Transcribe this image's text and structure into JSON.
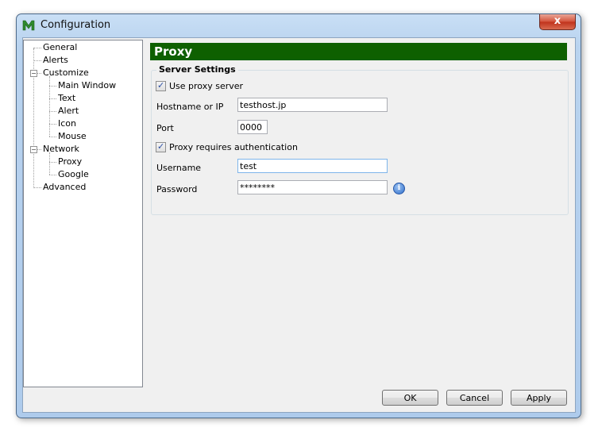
{
  "window": {
    "title": "Configuration",
    "close_label": "x"
  },
  "tree": {
    "items": [
      {
        "label": "General"
      },
      {
        "label": "Alerts"
      },
      {
        "label": "Customize",
        "expander": "−"
      },
      {
        "label": "Main Window"
      },
      {
        "label": "Text"
      },
      {
        "label": "Alert"
      },
      {
        "label": "Icon"
      },
      {
        "label": "Mouse"
      },
      {
        "label": "Network",
        "expander": "−"
      },
      {
        "label": "Proxy"
      },
      {
        "label": "Google"
      },
      {
        "label": "Advanced"
      }
    ]
  },
  "panel": {
    "header": "Proxy",
    "group_title": "Server Settings",
    "use_proxy": {
      "label": "Use proxy server",
      "checked": true
    },
    "hostname": {
      "label": "Hostname or IP",
      "value": "testhost.jp"
    },
    "port": {
      "label": "Port",
      "value": "0000"
    },
    "auth": {
      "label": "Proxy requires authentication",
      "checked": true
    },
    "username": {
      "label": "Username",
      "value": "test"
    },
    "password": {
      "label": "Password",
      "value": "********"
    },
    "info_icon": "i"
  },
  "buttons": {
    "ok": "OK",
    "cancel": "Cancel",
    "apply": "Apply"
  },
  "colors": {
    "header_bg": "#0e6000",
    "close_bg": "#c0321c"
  }
}
